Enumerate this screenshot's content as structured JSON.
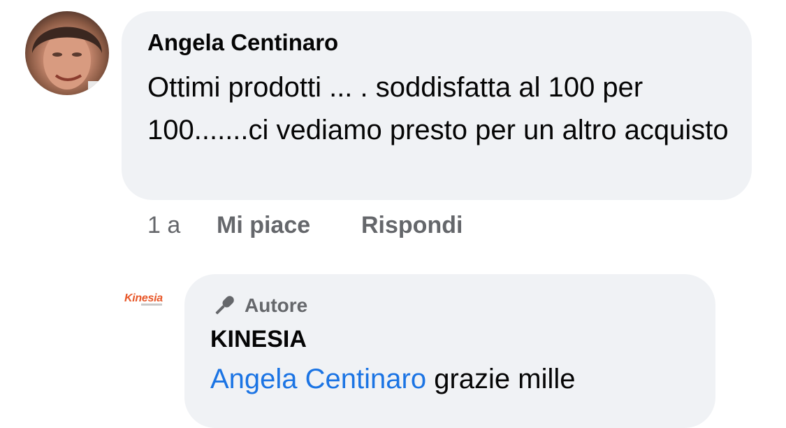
{
  "comment": {
    "author": "Angela Centinaro",
    "text": "Ottimi prodotti ... . soddisfatta al 100 per 100.......ci vediamo presto per un altro acquisto",
    "time": "1 a",
    "like_label": "Mi piace",
    "reply_label": "Rispondi"
  },
  "reply": {
    "logo_text": "Kinesia",
    "badge_icon": "microphone-icon",
    "badge_label": "Autore",
    "author": "KINESIA",
    "mention": "Angela Centinaro",
    "text": " grazie mille"
  },
  "colors": {
    "bubble": "#f0f2f5",
    "mention": "#1b74e4",
    "secondary_text": "#65676b",
    "logo": "#e8582a"
  }
}
